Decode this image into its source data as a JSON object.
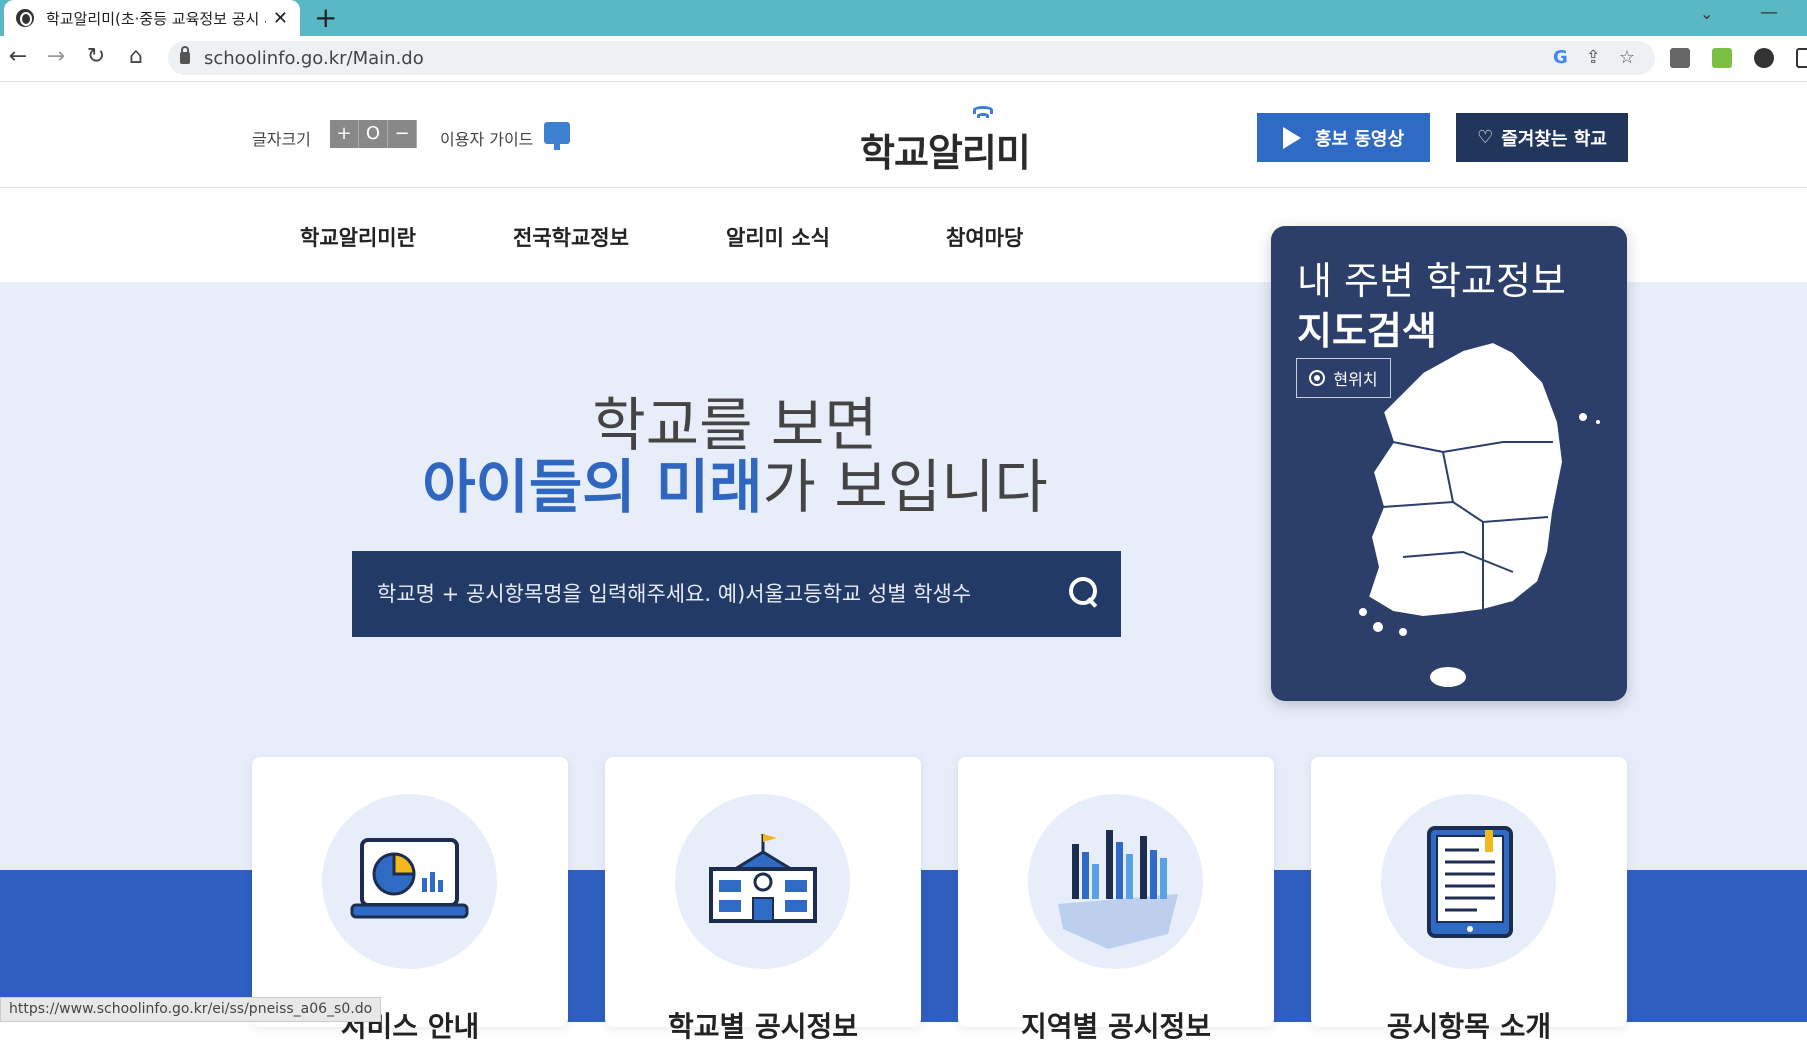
{
  "browser": {
    "tab_title": "학교알리미(초·중등 교육정보 공시 서비스)",
    "url": "schoolinfo.go.kr/Main.do",
    "status_url": "https://www.schoolinfo.go.kr/ei/ss/pneiss_a06_s0.do"
  },
  "header": {
    "fontsize_label": "글자크기",
    "fontsize_buttons": [
      "+",
      "O",
      "−"
    ],
    "guide_label": "이용자 가이드",
    "logo_text": "학교알리미",
    "promo_label": "홍보 동영상",
    "favorites_label": "즐겨찾는 학교"
  },
  "gnb": {
    "items": [
      "학교알리미란",
      "전국학교정보",
      "알리미 소식",
      "참여마당"
    ]
  },
  "hero": {
    "line1": "학교를 보면",
    "line2_highlight": "아이들의 미래",
    "line2_rest": "가 보입니다",
    "search_placeholder": "학교명 + 공시항목명을 입력해주세요. 예)서울고등학교 성별 학생수"
  },
  "map_card": {
    "title1": "내 주변 학교정보",
    "title2": "지도검색",
    "current_location": "현위치"
  },
  "cards": [
    {
      "title": "서비스 안내",
      "icon": "laptop-chart-icon"
    },
    {
      "title": "학교별 공시정보",
      "icon": "school-building-icon"
    },
    {
      "title": "지역별 공시정보",
      "icon": "region-bar-chart-icon"
    },
    {
      "title": "공시항목 소개",
      "icon": "document-tablet-icon"
    }
  ],
  "colors": {
    "primary_blue": "#2f6ac4",
    "navy": "#223a66",
    "hero_bg": "#e8eef9",
    "tab_bar": "#5ab8c4"
  }
}
